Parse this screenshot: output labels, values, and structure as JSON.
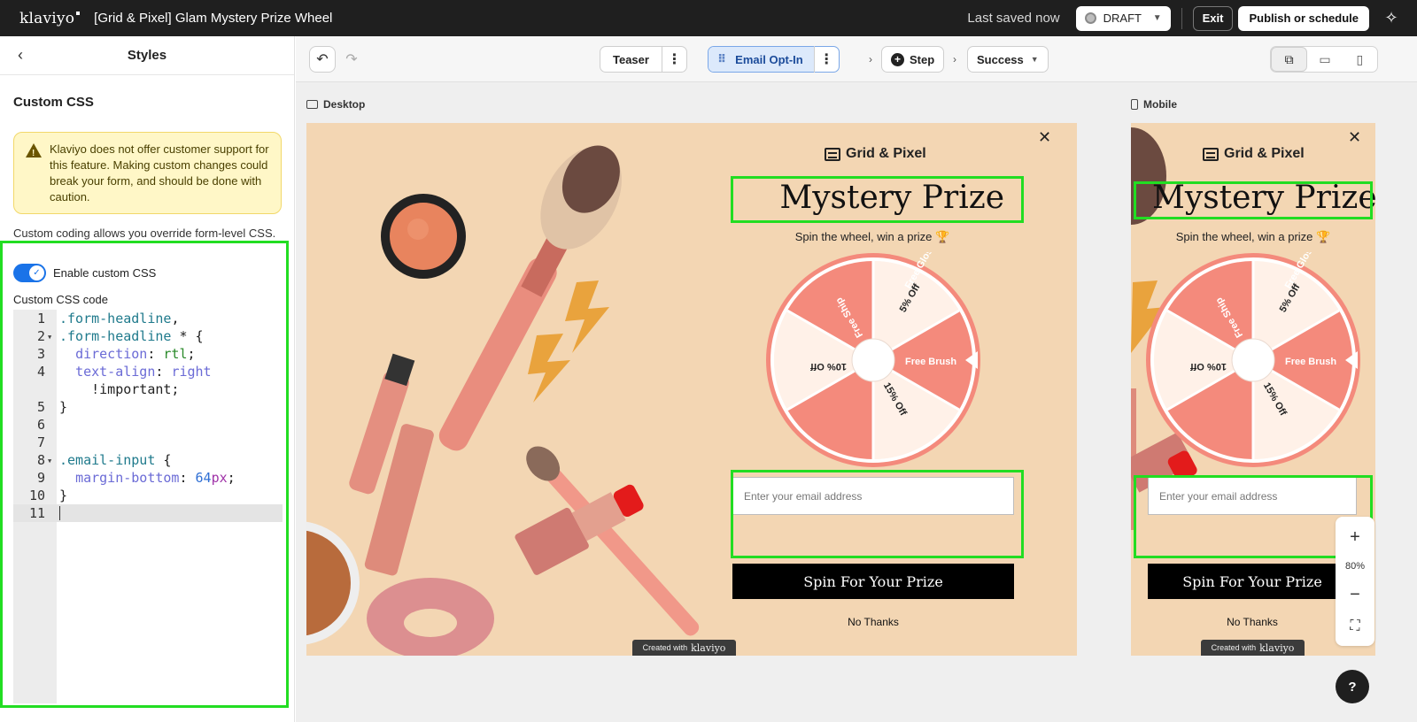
{
  "app": {
    "logo": "klaviyo",
    "title": "[Grid & Pixel] Glam Mystery Prize Wheel",
    "saved_status": "Last saved now",
    "status": "DRAFT",
    "exit_label": "Exit",
    "publish_label": "Publish or schedule"
  },
  "sidebar": {
    "title": "Styles",
    "section_title": "Custom CSS",
    "warning": "Klaviyo does not offer customer support for this feature. Making custom changes could break your form, and should be done with caution.",
    "description": "Custom coding allows you override form-level CSS.",
    "toggle_label": "Enable custom CSS",
    "toggle_on": true,
    "code_label": "Custom CSS code",
    "code_lines": [
      ".form-headline,",
      ".form-headline * {",
      "  direction: rtl;",
      "  text-align: right",
      "    !important;",
      "}",
      "",
      "",
      ".email-input {",
      "  margin-bottom: 64px;",
      "}",
      ""
    ],
    "line_numbers": [
      "1",
      "2",
      "3",
      "4",
      "",
      "5",
      "6",
      "7",
      "8",
      "9",
      "10",
      "11"
    ]
  },
  "toolbar": {
    "steps": [
      "Teaser",
      "Email Opt-In",
      "Step",
      "Success"
    ],
    "active_step": "Email Opt-In"
  },
  "preview": {
    "desktop_label": "Desktop",
    "mobile_label": "Mobile",
    "brand": "Grid & Pixel",
    "headline": "Mystery Prize",
    "subhead": "Spin the wheel, win a prize 🏆",
    "wheel_slices": [
      "5% Off",
      "Free Brush",
      "15% Off",
      "Free Gloss",
      "10% Off",
      "Free Ship"
    ],
    "email_placeholder": "Enter your email address",
    "cta": "Spin For Your Prize",
    "decline": "No Thanks",
    "created_with": "Created with",
    "created_brand": "klaviyo"
  },
  "zoom": {
    "level": "80%"
  },
  "help": "?",
  "colors": {
    "topbar": "#1f1f1f",
    "form_bg": "#f3d6b3",
    "wheel_coral": "#f48a7c",
    "wheel_cream": "#fff1e8",
    "highlight": "#22dd22",
    "toggle": "#1a73e8"
  }
}
